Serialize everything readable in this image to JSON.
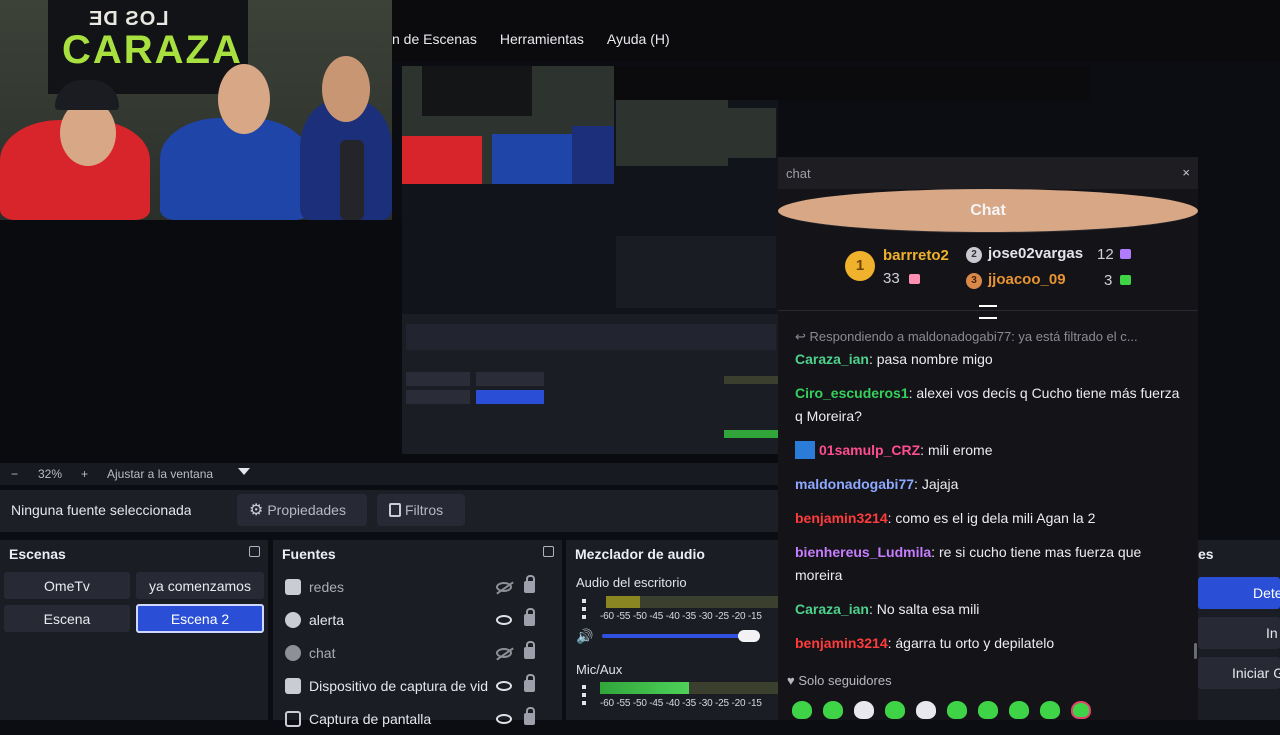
{
  "menubar": {
    "items": [
      "n de Escenas",
      "Herramientas",
      "Ayuda (H)"
    ]
  },
  "webcam": {
    "banner_line1": "LOS DE",
    "banner_line2": "CARAZA"
  },
  "zoombar": {
    "minus": "−",
    "zoom": "32%",
    "plus": "+",
    "fit": "Ajustar a la ventana"
  },
  "source_toolbar": {
    "no_source": "Ninguna fuente seleccionada",
    "properties": "Propiedades",
    "filters": "Filtros"
  },
  "scenes": {
    "title": "Escenas",
    "items": [
      "OmeTv",
      "ya comenzamos",
      "Escena",
      "Escena 2"
    ],
    "active": "Escena 2"
  },
  "sources": {
    "title": "Fuentes",
    "items": [
      {
        "label": "redes",
        "icon": "browser-icon",
        "visible": false
      },
      {
        "label": "alerta",
        "icon": "globe-icon",
        "visible": true
      },
      {
        "label": "chat",
        "icon": "globe-icon",
        "visible": false
      },
      {
        "label": "Dispositivo de captura de vid",
        "icon": "camera-icon",
        "visible": true
      },
      {
        "label": "Captura de pantalla",
        "icon": "monitor-icon",
        "visible": true
      }
    ]
  },
  "mixer": {
    "title": "Mezclador de audio",
    "channels": [
      {
        "name": "Audio del escritorio",
        "level": 0.2
      },
      {
        "name": "Mic/Aux",
        "level": 0.5
      }
    ],
    "scale": "-60 -55 -50 -45 -40 -35 -30 -25 -20 -15"
  },
  "controls": {
    "title_partial": "es",
    "buttons": [
      "Dete",
      "In",
      "Iniciar G"
    ]
  },
  "chat": {
    "window_title": "chat",
    "close": "×",
    "header": "Chat",
    "leaderboard": {
      "first": {
        "rank": "1",
        "name": "barrreto2",
        "count": "33"
      },
      "second": {
        "rank": "2",
        "name": "jose02vargas",
        "count": "12"
      },
      "third": {
        "rank": "3",
        "name": "jjoacoo_09",
        "count": "3"
      }
    },
    "reply_line": "Respondiendo a maldonadogabi77: ya está filtrado el c...",
    "messages": [
      {
        "user": "Caraza_ian",
        "color": "#4ed18c",
        "text": "pasa nombre migo"
      },
      {
        "user": "Ciro_escuderos1",
        "color": "#35d05c",
        "text": "alexei vos decís q Cucho tiene más fuerza q Moreira?"
      },
      {
        "user": "01samulp_CRZ",
        "color": "#ff4d8f",
        "text": "mili erome"
      },
      {
        "user": "maldonadogabi77",
        "color": "#8ea9ff",
        "text": "Jajaja"
      },
      {
        "user": "benjamin3214",
        "color": "#ff3b3b",
        "text": "como es el ig dela mili Agan la 2"
      },
      {
        "user": "bienhereus_Ludmila",
        "color": "#c77dff",
        "text": "re si cucho tiene mas fuerza que moreira"
      },
      {
        "user": "Caraza_ian",
        "color": "#4ed18c",
        "text": "No salta esa mili"
      },
      {
        "user": "benjamin3214",
        "color": "#ff3b3b",
        "text": "ágarra tu orto y depilatelo"
      }
    ],
    "footer": "Solo seguidores",
    "accent": "#3fd447"
  }
}
